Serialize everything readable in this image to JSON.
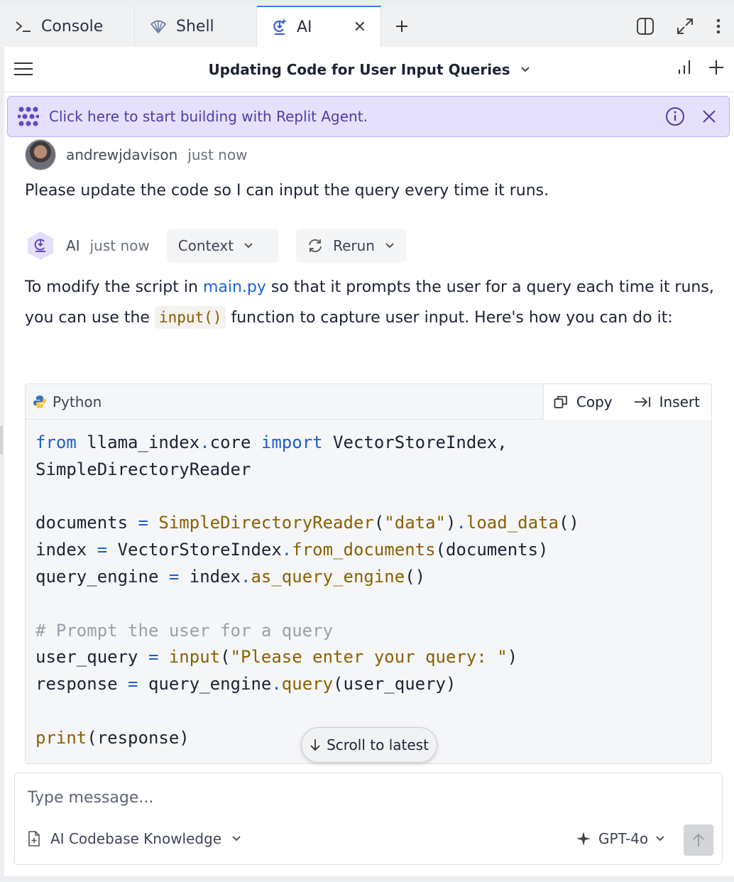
{
  "tabs": [
    {
      "label": "Console",
      "icon": "terminal-icon"
    },
    {
      "label": "Shell",
      "icon": "shell-icon"
    },
    {
      "label": "AI",
      "icon": "ai-icon",
      "active": true
    }
  ],
  "header": {
    "title": "Updating Code for User Input Queries"
  },
  "banner": {
    "text": "Click here to start building with Replit Agent."
  },
  "user_message": {
    "username": "andrewjdavison",
    "time": "just now",
    "text": "Please update the code so I can input the query every time it runs."
  },
  "ai_message": {
    "name": "AI",
    "time": "just now",
    "context_label": "Context",
    "rerun_label": "Rerun",
    "text_before_link": "To modify the script in ",
    "link": "main.py",
    "text_after_link": " so that it prompts the user for a query each time it runs, you can use the ",
    "inline_code": "input()",
    "text_end": " function to capture user input. Here's how you can do it:"
  },
  "code_block": {
    "language": "Python",
    "copy_label": "Copy",
    "insert_label": "Insert"
  },
  "scroll_latest": "Scroll to latest",
  "composer": {
    "placeholder": "Type message...",
    "knowledge_label": "AI Codebase Knowledge",
    "model": "GPT-4o"
  },
  "colors": {
    "accent": "#3c7cf0",
    "banner_bg": "#e5e0fb",
    "banner_text": "#4b3fa8",
    "link": "#1a63d8"
  }
}
